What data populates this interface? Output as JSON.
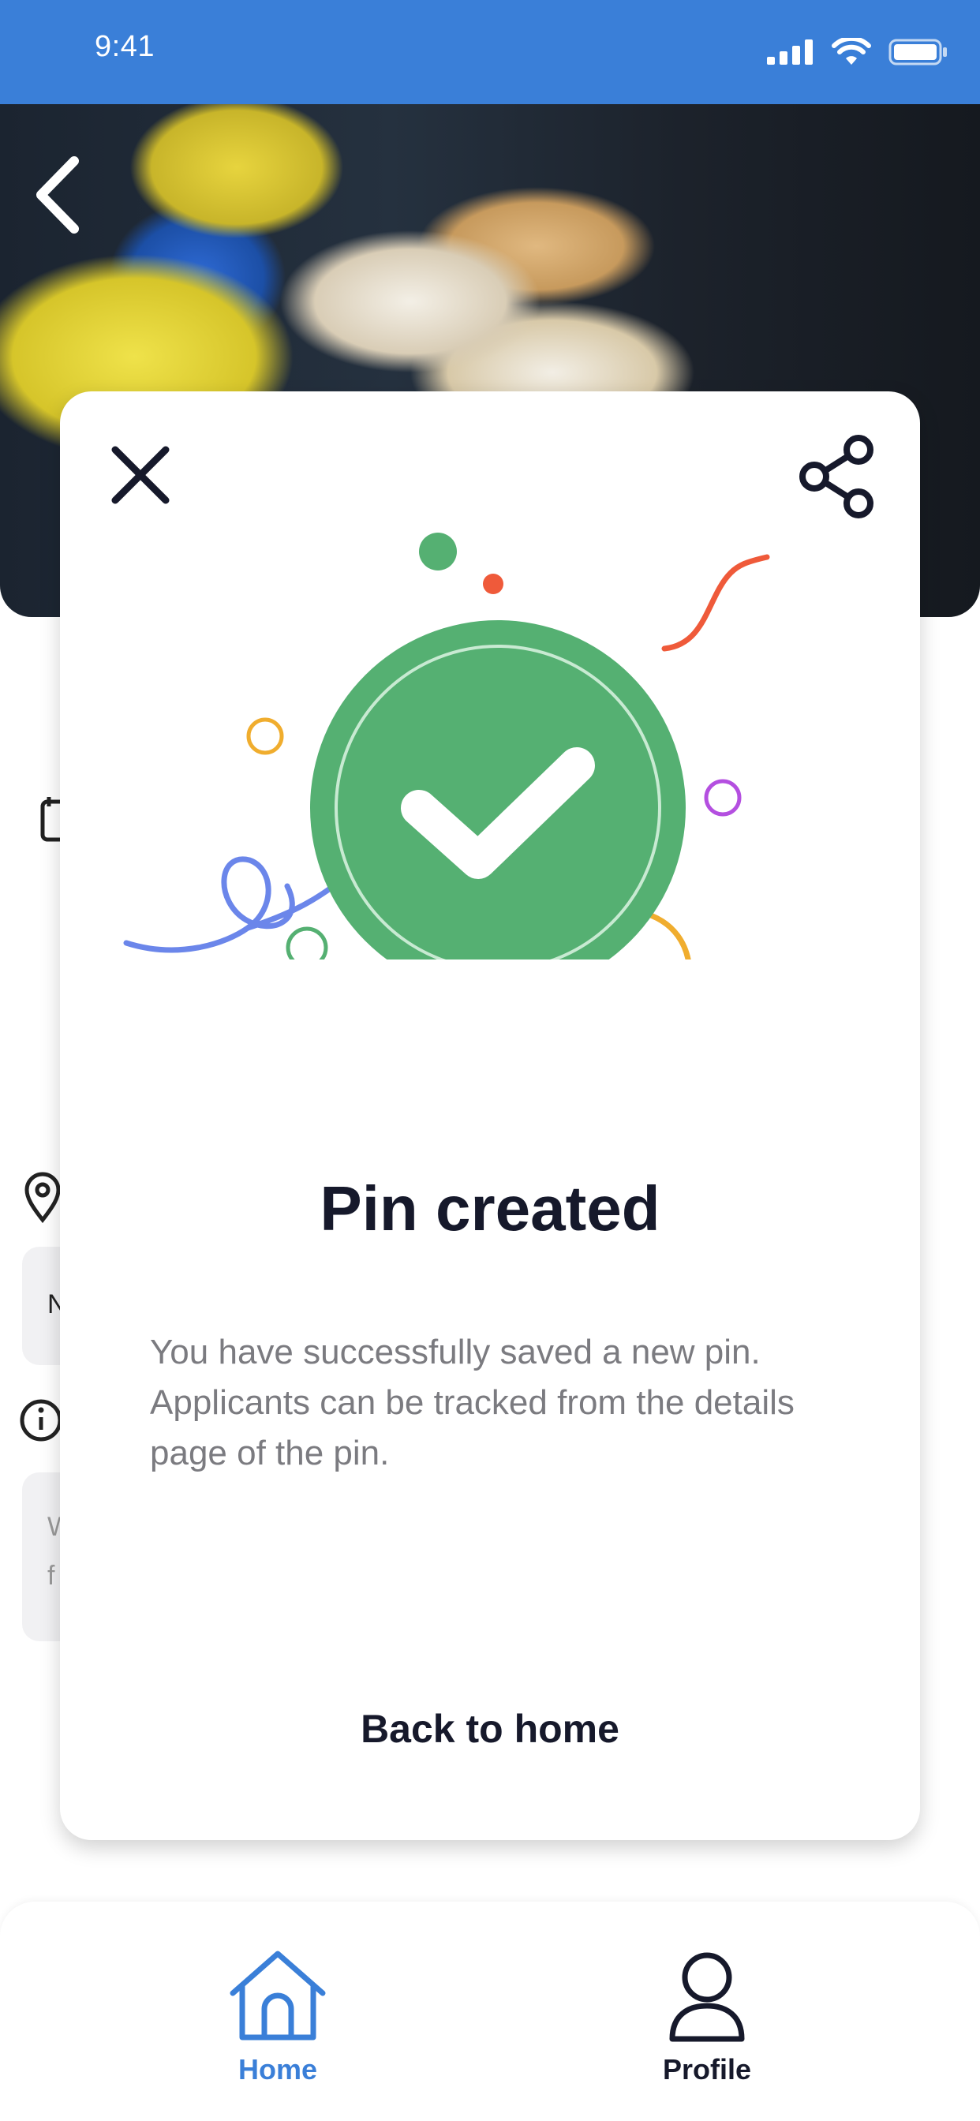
{
  "status_bar": {
    "time": "9:41"
  },
  "modal": {
    "title": "Pin created",
    "message": "You have successfully saved a new pin. Applicants can be tracked from the details page of the pin.",
    "back_home_label": "Back to home"
  },
  "background_fragments": {
    "field_letter_1": "N",
    "field_letter_2": "W",
    "field_letter_3": "f"
  },
  "bottom_nav": {
    "items": [
      {
        "label": "Home",
        "icon": "home-icon",
        "active": true
      },
      {
        "label": "Profile",
        "icon": "profile-icon",
        "active": false
      }
    ]
  },
  "colors": {
    "brand_blue": "#3a7fd8",
    "success_green": "#55b072",
    "text_dark": "#16192b",
    "text_grey": "#7b7b80"
  }
}
